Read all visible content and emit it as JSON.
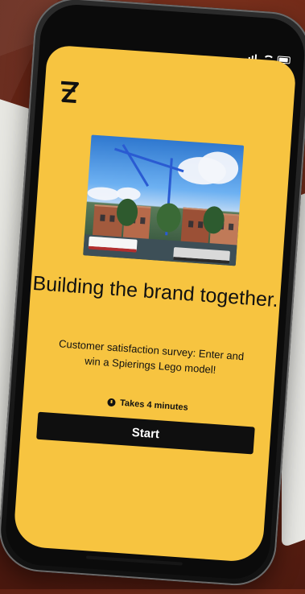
{
  "background": {
    "wall_colors": [
      "#8a3a22",
      "#6b2616",
      "#4a180e"
    ],
    "panel_color": "#e7e7e2"
  },
  "device": {
    "frame_color": "#111111",
    "screen_color": "#f7c440"
  },
  "status_bar": {
    "icons": [
      "signal-icon",
      "wifi-icon",
      "battery-icon"
    ],
    "text_color": "#ffffff"
  },
  "app": {
    "logo_icon": "brand-logo-icon",
    "hero_image": "photo-crane-canal-buildings",
    "title": "Building the brand together.",
    "subtitle": "Customer satisfaction survey: Enter and win a Spierings Lego model!",
    "duration_icon": "clock-icon",
    "duration_text": "Takes 4 minutes",
    "start_label": "Start",
    "accent": "#f7c440",
    "button_color": "#0f0f0f"
  }
}
